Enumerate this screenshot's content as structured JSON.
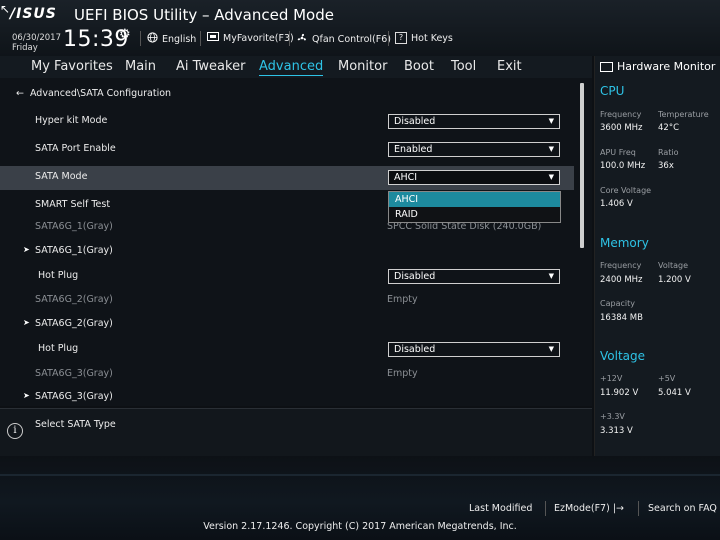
{
  "header": {
    "logo": "/ISUS",
    "title": "UEFI BIOS Utility – Advanced Mode",
    "date": "06/30/2017",
    "day": "Friday",
    "time": "15:39",
    "language": "English",
    "myfavorite": "MyFavorite(F3)",
    "qfan": "Qfan Control(F6)",
    "hotkeys": "Hot Keys"
  },
  "menu": {
    "items": [
      "My Favorites",
      "Main",
      "Ai Tweaker",
      "Advanced",
      "Monitor",
      "Boot",
      "Tool",
      "Exit"
    ],
    "active": "Advanced"
  },
  "page": {
    "breadcrumb": "Advanced\\SATA Configuration",
    "rows": [
      {
        "label": "Hyper kit Mode",
        "value": "Disabled"
      },
      {
        "label": "SATA Port Enable",
        "value": "Enabled"
      },
      {
        "label": "SATA Mode",
        "value": "AHCI"
      },
      {
        "label": "SMART Self Test"
      },
      {
        "label": "SATA6G_1(Gray)",
        "value": "SPCC Solid State Disk (240.0GB)"
      },
      {
        "label": "SATA6G_1(Gray)"
      },
      {
        "label": "Hot Plug",
        "value": "Disabled"
      },
      {
        "label": "SATA6G_2(Gray)",
        "value": "Empty"
      },
      {
        "label": "SATA6G_2(Gray)"
      },
      {
        "label": "Hot Plug",
        "value": "Disabled"
      },
      {
        "label": "SATA6G_3(Gray)",
        "value": "Empty"
      },
      {
        "label": "SATA6G_3(Gray)"
      }
    ],
    "sata_mode_options": [
      "AHCI",
      "RAID"
    ],
    "sata_mode_selected": "AHCI"
  },
  "help": {
    "text": "Select SATA Type"
  },
  "hardware_monitor": {
    "title": "Hardware Monitor",
    "cpu": {
      "heading": "CPU",
      "frequency_label": "Frequency",
      "frequency": "3600 MHz",
      "temperature_label": "Temperature",
      "temperature": "42°C",
      "apu_freq_label": "APU Freq",
      "apu_freq": "100.0 MHz",
      "ratio_label": "Ratio",
      "ratio": "36x",
      "core_voltage_label": "Core Voltage",
      "core_voltage": "1.406 V"
    },
    "memory": {
      "heading": "Memory",
      "frequency_label": "Frequency",
      "frequency": "2400 MHz",
      "voltage_label": "Voltage",
      "voltage": "1.200 V",
      "capacity_label": "Capacity",
      "capacity": "16384 MB"
    },
    "voltage": {
      "heading": "Voltage",
      "v12_label": "+12V",
      "v12": "11.902 V",
      "v5_label": "+5V",
      "v5": "5.041 V",
      "v33_label": "+3.3V",
      "v33": "3.313 V"
    }
  },
  "footer": {
    "last_modified": "Last Modified",
    "ezmode": "EzMode(F7)",
    "search_faq": "Search on FAQ",
    "copyright": "Version 2.17.1246. Copyright (C) 2017 American Megatrends, Inc."
  },
  "colors": {
    "accent": "#2ec3e6",
    "selected_option": "#1d8a9e",
    "highlight_row": "#3a4048"
  }
}
